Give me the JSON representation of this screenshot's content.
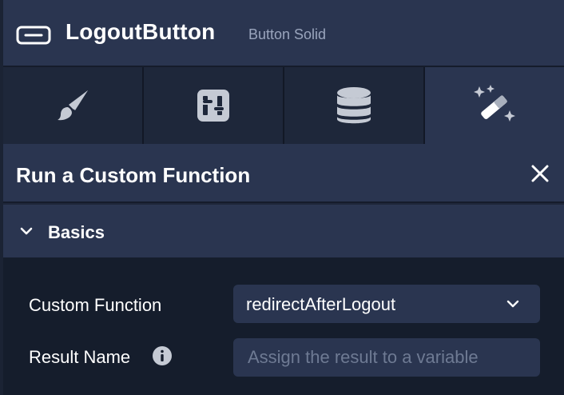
{
  "header": {
    "title": "LogoutButton",
    "subtitle": "Button Solid",
    "icon": "button-outline-icon"
  },
  "tabs": [
    {
      "name": "style",
      "icon": "paintbrush-icon",
      "active": false
    },
    {
      "name": "properties",
      "icon": "sliders-icon",
      "active": false
    },
    {
      "name": "data",
      "icon": "database-icon",
      "active": false
    },
    {
      "name": "actions",
      "icon": "magic-wand-icon",
      "active": true
    }
  ],
  "section": {
    "title": "Run a Custom Function",
    "close_icon": "close-icon"
  },
  "basics": {
    "label": "Basics",
    "expanded": true
  },
  "form": {
    "custom_function_label": "Custom Function",
    "custom_function_value": "redirectAfterLogout",
    "result_name_label": "Result Name",
    "result_name_placeholder": "Assign the result to a variable",
    "result_name_value": ""
  },
  "colors": {
    "header_bg": "#2a3550",
    "panel_bg": "#1e273a",
    "body_bg": "#151d2c",
    "icon_gray": "#d0d4dc"
  }
}
